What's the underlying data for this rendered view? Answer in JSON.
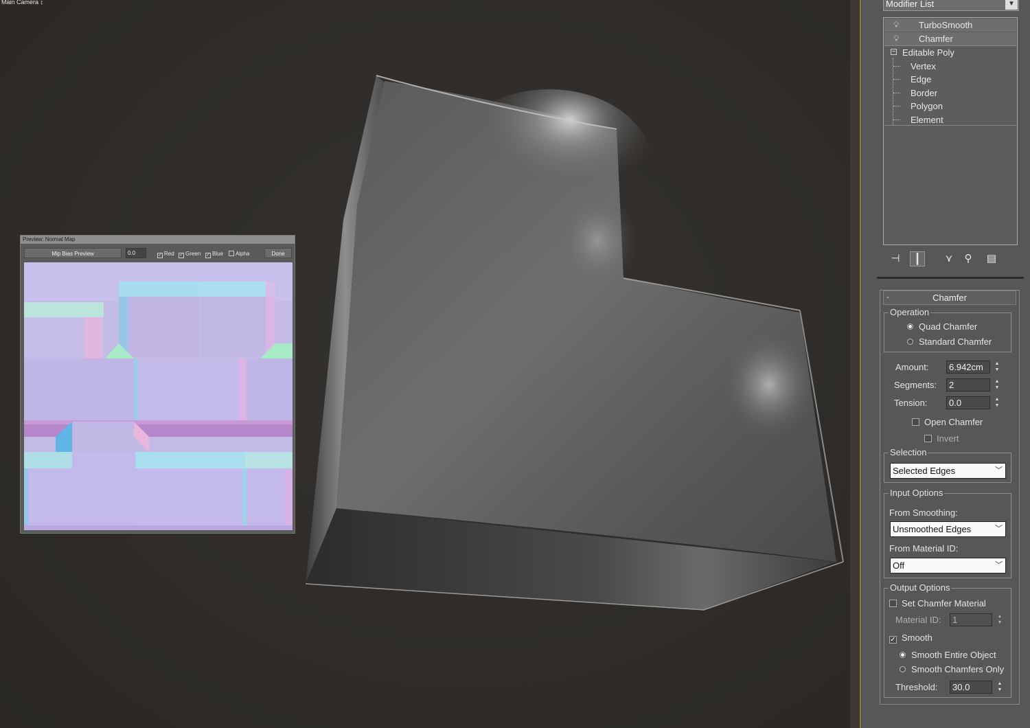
{
  "viewport": {
    "label": "Main Camera ↕"
  },
  "preview": {
    "title": "Preview: Normal Map",
    "mip_bias_button": "Mip Bias Preview",
    "mip_bias_value": "0.0",
    "channels": [
      {
        "label": "Red",
        "checked": true
      },
      {
        "label": "Green",
        "checked": true
      },
      {
        "label": "Blue",
        "checked": true
      },
      {
        "label": "Alpha",
        "checked": false
      }
    ],
    "done_button": "Done"
  },
  "command_panel": {
    "modifier_list": "Modifier List",
    "stack": [
      {
        "label": "TurboSmooth",
        "icon": "lightbulb-icon"
      },
      {
        "label": "Chamfer",
        "icon": "lightbulb-icon"
      },
      {
        "label": "Editable Poly",
        "icon": "collapse-minus-icon"
      },
      {
        "label": "Vertex"
      },
      {
        "label": "Edge"
      },
      {
        "label": "Border"
      },
      {
        "label": "Polygon"
      },
      {
        "label": "Element"
      }
    ],
    "stack_tools": [
      "pin-stack-icon",
      "show-end-result-icon",
      "make-unique-icon",
      "remove-modifier-icon",
      "configure-sets-icon"
    ]
  },
  "chamfer": {
    "title": "Chamfer",
    "operation": {
      "title": "Operation",
      "quad": "Quad Chamfer",
      "standard": "Standard Chamfer",
      "selected": "Quad Chamfer"
    },
    "amount_label": "Amount:",
    "amount_value": "6.942cm",
    "segments_label": "Segments:",
    "segments_value": "2",
    "tension_label": "Tension:",
    "tension_value": "0.0",
    "open_chamfer": "Open Chamfer",
    "invert": "Invert",
    "selection": {
      "title": "Selection",
      "value": "Selected Edges"
    },
    "input_options": {
      "title": "Input Options",
      "from_smoothing_label": "From Smoothing:",
      "from_smoothing_value": "Unsmoothed Edges",
      "from_material_label": "From Material ID:",
      "from_material_value": "Off"
    },
    "output_options": {
      "title": "Output Options",
      "set_chamfer_material": "Set Chamfer Material",
      "material_id_label": "Material ID:",
      "material_id_value": "1",
      "smooth": "Smooth",
      "smooth_entire": "Smooth Entire Object",
      "smooth_chamfers_only": "Smooth Chamfers Only",
      "threshold_label": "Threshold:",
      "threshold_value": "30.0"
    }
  },
  "colors": {
    "viewport_bg": "#2f2c29",
    "panel_bg": "#575757",
    "gold_accent": "#8b7a3a"
  }
}
